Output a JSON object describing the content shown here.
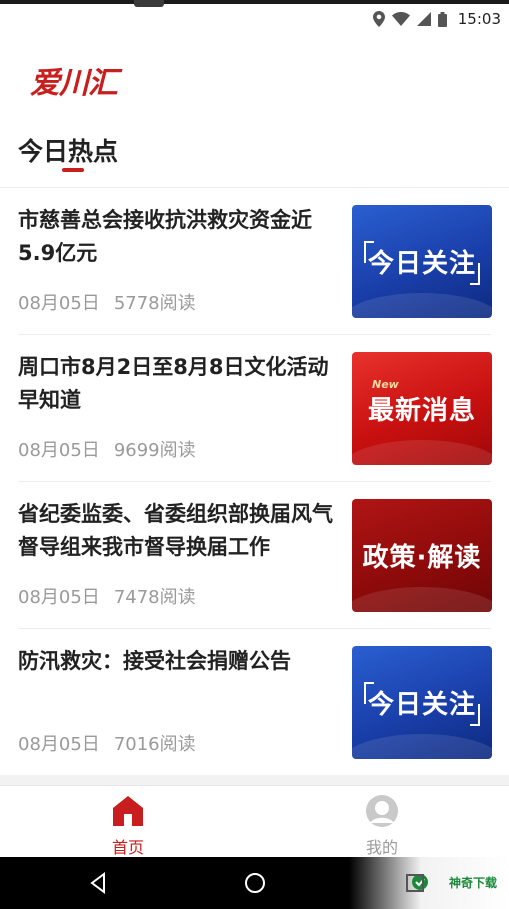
{
  "status_bar": {
    "time": "15:03",
    "icons": [
      "location-icon",
      "wifi-icon",
      "signal-icon",
      "battery-icon"
    ]
  },
  "app": {
    "logo_text": "爱川汇"
  },
  "section": {
    "title": "今日热点"
  },
  "news": [
    {
      "title": "市慈善总会接收抗洪救灾资金近5.9亿元",
      "date": "08月05日",
      "reads": "5778阅读",
      "thumb_text": "今日关注",
      "thumb_style": "blue"
    },
    {
      "title": "周口市8月2日至8月8日文化活动早知道",
      "date": "08月05日",
      "reads": "9699阅读",
      "thumb_text": "最新消息",
      "thumb_badge": "New",
      "thumb_style": "red"
    },
    {
      "title": "省纪委监委、省委组织部换届风气督导组来我市督导换届工作",
      "date": "08月05日",
      "reads": "7478阅读",
      "thumb_text": "政策·解读",
      "thumb_style": "darkred"
    },
    {
      "title": "防汛救灾：接受社会捐赠公告",
      "date": "08月05日",
      "reads": "7016阅读",
      "thumb_text": "今日关注",
      "thumb_style": "blue"
    }
  ],
  "tabs": [
    {
      "label": "首页",
      "active": true
    },
    {
      "label": "我的",
      "active": false
    }
  ],
  "watermark": {
    "text": "神奇下载"
  },
  "colors": {
    "accent": "#c81e1e",
    "meta_gray": "#9a9a9a",
    "title": "#222222"
  }
}
